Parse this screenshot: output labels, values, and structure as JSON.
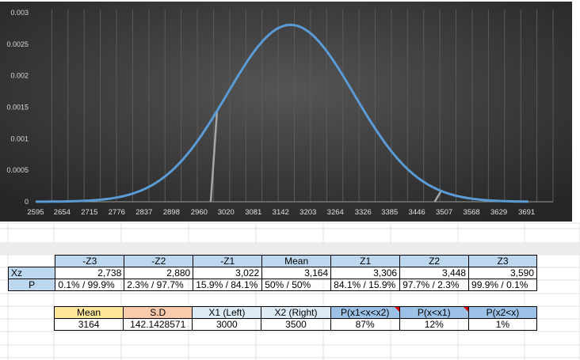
{
  "chart_data": {
    "type": "line",
    "x_ticks": [
      2595,
      2654,
      2715,
      2776,
      2837,
      2898,
      2960,
      3020,
      3081,
      3142,
      3203,
      3264,
      3326,
      3385,
      3446,
      3507,
      3568,
      3629,
      3691
    ],
    "y_ticks": [
      "0",
      "0.0005",
      "0.001",
      "0.0015",
      "0.002",
      "0.0025",
      "0.003"
    ],
    "xlim": [
      2595,
      3750
    ],
    "ylim": [
      0,
      0.003
    ],
    "series": [
      {
        "kind": "normal-pdf",
        "mean": 3164,
        "sd": 142.1428571,
        "color": "#5b9bd5"
      }
    ],
    "markers": [
      {
        "x": 3000,
        "color": "#a6a6a6"
      },
      {
        "x": 3500,
        "color": "#a6a6a6"
      }
    ],
    "background": "#3a3a3a",
    "grid": "vertical"
  },
  "z_table": {
    "label_xz": "Xz",
    "label_p": "P",
    "headers": [
      "-Z3",
      "-Z2",
      "-Z1",
      "Mean",
      "Z1",
      "Z2",
      "Z3"
    ],
    "xz": [
      "2,738",
      "2,880",
      "3,022",
      "3,164",
      "3,306",
      "3,448",
      "3,590"
    ],
    "p": [
      "0.1% / 99.9%",
      "2.3% / 97.7%",
      "15.9% / 84.1%",
      "50% / 50%",
      "84.1% / 15.9%",
      "97.7% / 2.3%",
      "99.9% / 0.1%"
    ]
  },
  "input_table": {
    "headers": [
      "Mean",
      "S.D",
      "X1 (Left)",
      "X2 (Right)",
      "P(x1<x<x2)",
      "P(x<x1)",
      "P(x2<x)"
    ],
    "values": [
      "3164",
      "142.1428571",
      "3000",
      "3500",
      "87%",
      "12%",
      "1%"
    ]
  },
  "colors": {
    "curve": "#5b9bd5",
    "chart_bg_outer": "#2a2a2a",
    "header_blue": "#bdd7ee",
    "mean_gold": "#ffe699",
    "sd_peach": "#f8cbad"
  }
}
